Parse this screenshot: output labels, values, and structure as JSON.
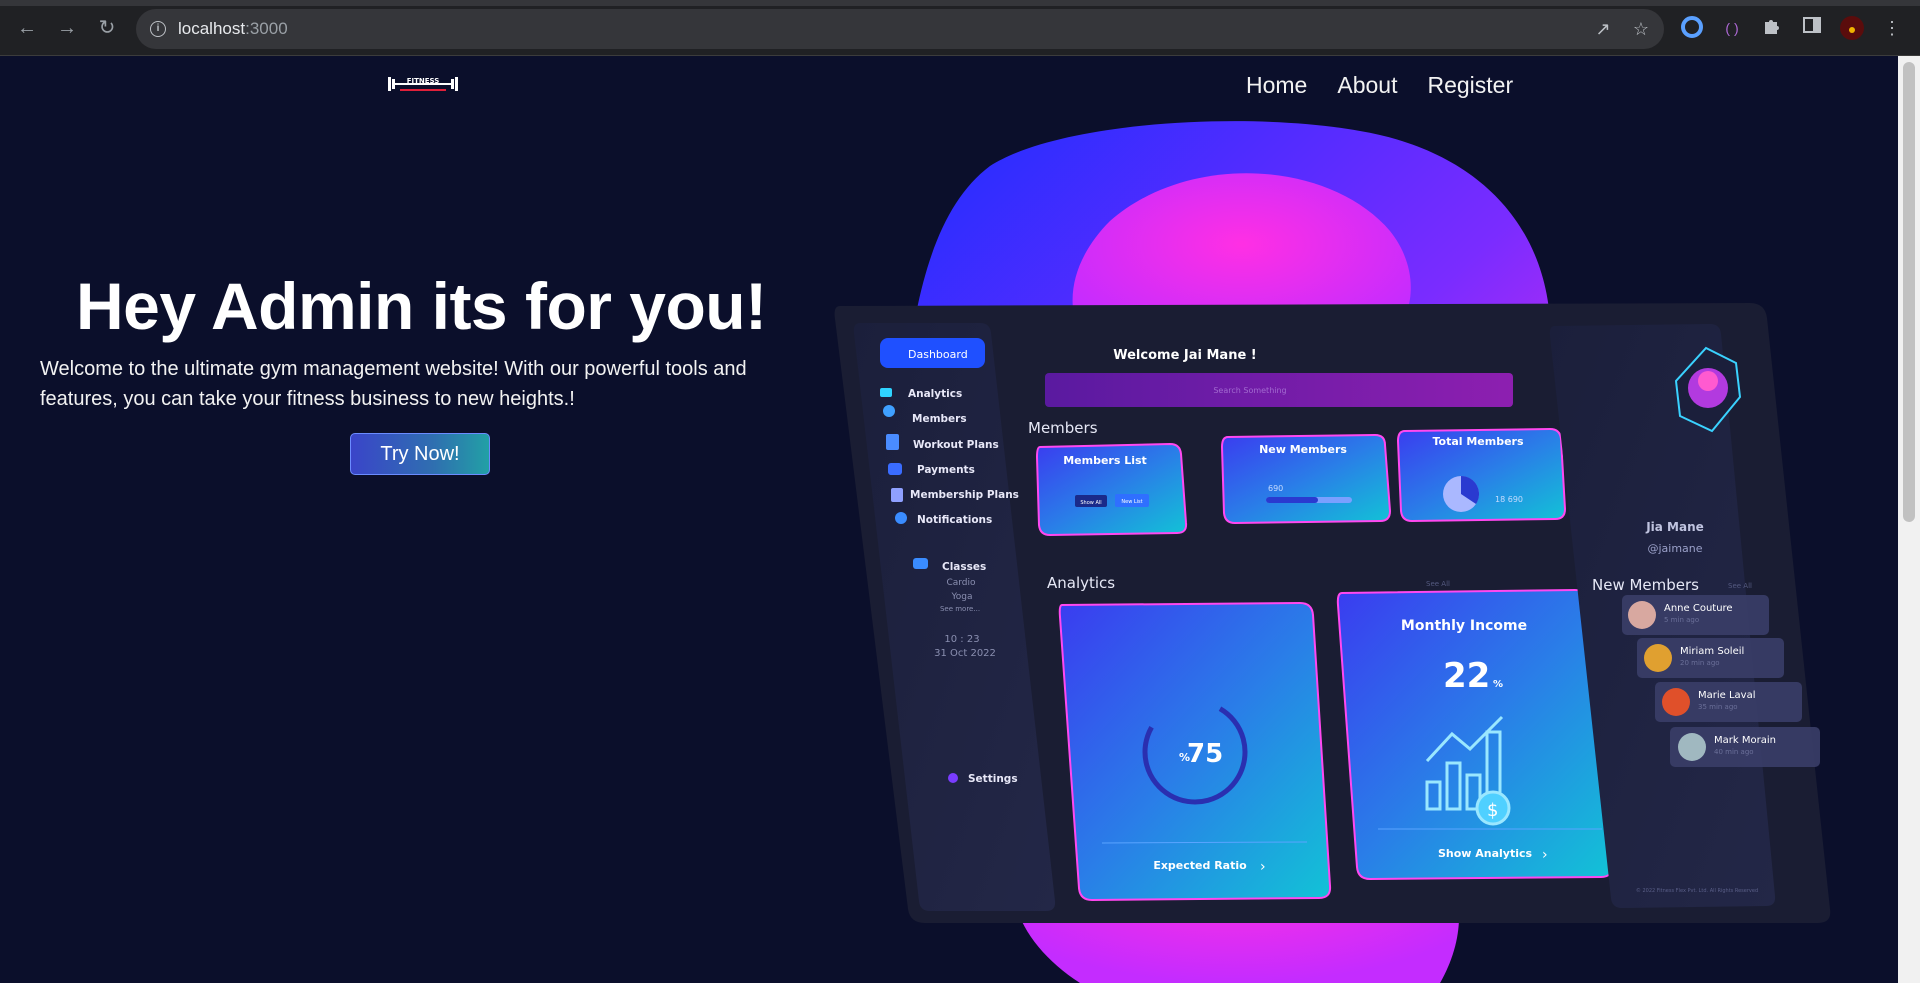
{
  "browser": {
    "url_host": "localhost",
    "url_port": ":3000"
  },
  "nav": {
    "logo_text": "FITNESS",
    "links": [
      "Home",
      "About",
      "Register"
    ]
  },
  "hero": {
    "title": "Hey Admin its for you!",
    "text": "Welcome to the ultimate gym management website! With our powerful tools and features, you can take your fitness business to new heights.!",
    "cta": "Try Now!"
  },
  "dashboard": {
    "sidebar": {
      "active": "Dashboard",
      "items": [
        "Analytics",
        "Members",
        "Workout Plans",
        "Payments",
        "Membership Plans",
        "Notifications"
      ],
      "classes_label": "Classes",
      "classes": [
        "Cardio",
        "Yoga"
      ],
      "see_more": "See more...",
      "time": "10 : 23",
      "date": "31 Oct 2022",
      "settings": "Settings"
    },
    "welcome": "Welcome  Jai Mane !",
    "search_placeholder": "Search Something",
    "members_heading": "Members",
    "cards": {
      "members_list": "Members List",
      "show_all": "Show All",
      "new_list": "New List",
      "new_members": "New Members",
      "new_members_value": "690",
      "total_members": "Total Members",
      "total_members_value": "18 690"
    },
    "analytics_heading": "Analytics",
    "see_all": "See All",
    "expected_ratio_value": "75",
    "expected_ratio_unit": "%",
    "expected_ratio_label": "Expected Ratio",
    "income_title": "Monthly Income",
    "income_value": "22",
    "income_unit": "%",
    "show_analytics": "Show Analytics",
    "profile": {
      "name": "Jia Mane",
      "handle": "@jaimane"
    },
    "new_members_heading": "New Members",
    "new_members_list": [
      {
        "name": "Anne Couture",
        "time": "5 min ago"
      },
      {
        "name": "Miriam Soleil",
        "time": "20 min ago"
      },
      {
        "name": "Marie Laval",
        "time": "35 min ago"
      },
      {
        "name": "Mark  Morain",
        "time": "40 min ago"
      }
    ],
    "footer": "© 2022 Fitness Flex Pvt. Ltd. All Rights Reserved"
  },
  "colors": {
    "page_bg": "#0b0f2b",
    "blob_pink": "#ff2fe4",
    "blob_blue": "#1f2cff",
    "card_cyan": "#12c3d6"
  }
}
